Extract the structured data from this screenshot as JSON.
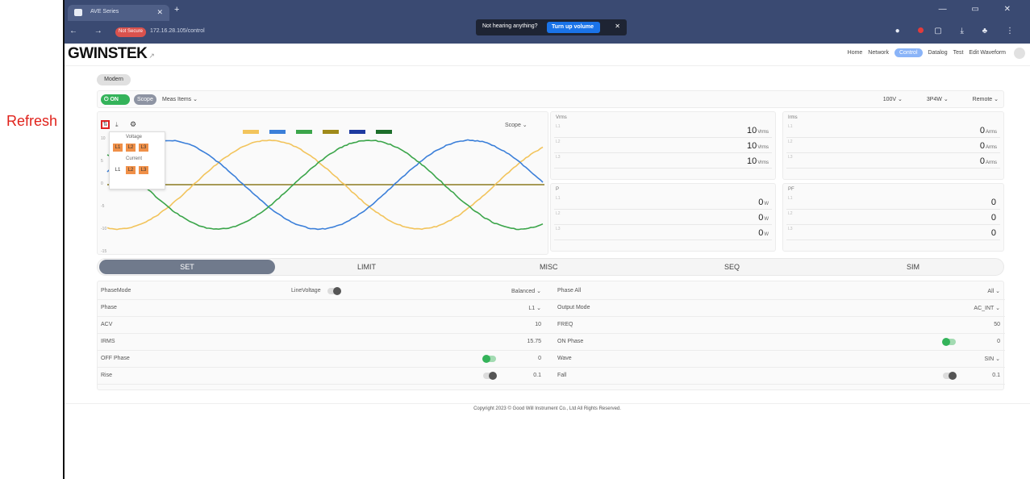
{
  "annotation": {
    "label": "Refresh"
  },
  "browser": {
    "tab_title": "AVE Series",
    "plus": "+",
    "nav": "← → C ⌂",
    "badge": "Not Secure",
    "url": "172.16.28.105/control",
    "window_controls": "— ▭ ✕",
    "toast_text": "Not hearing anything?",
    "toast_button": "Turn up volume",
    "toast_close": "✕"
  },
  "header": {
    "logo": "GWINSTEK",
    "menu": [
      "Home",
      "Network",
      "Control",
      "Datalog",
      "Test",
      "Edit Waveform"
    ],
    "active": "Control"
  },
  "mode": {
    "label": "Modern"
  },
  "controlbar": {
    "on": "ON",
    "scope": "Scope",
    "meas": "Meas Items ⌄",
    "voltage": "100V ⌄",
    "wiring": "3P4W ⌄",
    "remote": "Remote ⌄"
  },
  "scope": {
    "refresh_glyph": "⇅",
    "download_glyph": "⤓",
    "gear_glyph": "⚙",
    "select": "Scope ⌄",
    "popup": {
      "voltage_label": "Voltage",
      "current_label": "Current",
      "voltage": [
        "L1",
        "L2",
        "L3"
      ],
      "current": [
        "L1",
        "L2",
        "L3"
      ]
    },
    "legend_colors": [
      "#f2c45c",
      "#3b7fd9",
      "#3ba54a",
      "#a08a1a",
      "#1e3aa0",
      "#1d6e2b"
    ],
    "y_ticks": [
      "10",
      "5",
      "0",
      "-5",
      "-10",
      "-15"
    ]
  },
  "meters": {
    "vrms": {
      "title": "Vrms",
      "rows": [
        {
          "lb": "L1",
          "v": "10",
          "u": "Vrms"
        },
        {
          "lb": "L2",
          "v": "10",
          "u": "Vrms"
        },
        {
          "lb": "L3",
          "v": "10",
          "u": "Vrms"
        }
      ]
    },
    "irms": {
      "title": "Irms",
      "rows": [
        {
          "lb": "L1",
          "v": "0",
          "u": "Arms"
        },
        {
          "lb": "L2",
          "v": "0",
          "u": "Arms"
        },
        {
          "lb": "L3",
          "v": "0",
          "u": "Arms"
        }
      ]
    },
    "p": {
      "title": "P",
      "rows": [
        {
          "lb": "L1",
          "v": "0",
          "u": "W"
        },
        {
          "lb": "L2",
          "v": "0",
          "u": "W"
        },
        {
          "lb": "L3",
          "v": "0",
          "u": "W"
        }
      ]
    },
    "pf": {
      "title": "PF",
      "rows": [
        {
          "lb": "L1",
          "v": "0",
          "u": ""
        },
        {
          "lb": "L2",
          "v": "0",
          "u": ""
        },
        {
          "lb": "L3",
          "v": "0",
          "u": ""
        }
      ]
    }
  },
  "tabs": [
    "SET",
    "LIMIT",
    "MISC",
    "SEQ",
    "SIM"
  ],
  "settings": {
    "rows": [
      {
        "l": "PhaseMode",
        "mid_label": "LineVoltage",
        "vm": "Balanced ⌄",
        "lr": "Phase All",
        "vr": "All ⌄"
      },
      {
        "l": "Phase",
        "vm": "L1 ⌄",
        "lr": "Output Mode",
        "vr": "AC_INT ⌄"
      },
      {
        "l": "ACV",
        "vm": "10",
        "lr": "FREQ",
        "vr": "50"
      },
      {
        "l": "IRMS",
        "vm": "15.75",
        "lr": "ON Phase",
        "vr": "0"
      },
      {
        "l": "OFF Phase",
        "vm": "0",
        "lr": "Wave",
        "vr": "SIN ⌄"
      },
      {
        "l": "Rise",
        "vm": "0.1",
        "lr": "Fall",
        "vr": "0.1"
      }
    ]
  },
  "footer": "Copyright 2023 © Good Will Instrument Co., Ltd All Rights Reserved."
}
